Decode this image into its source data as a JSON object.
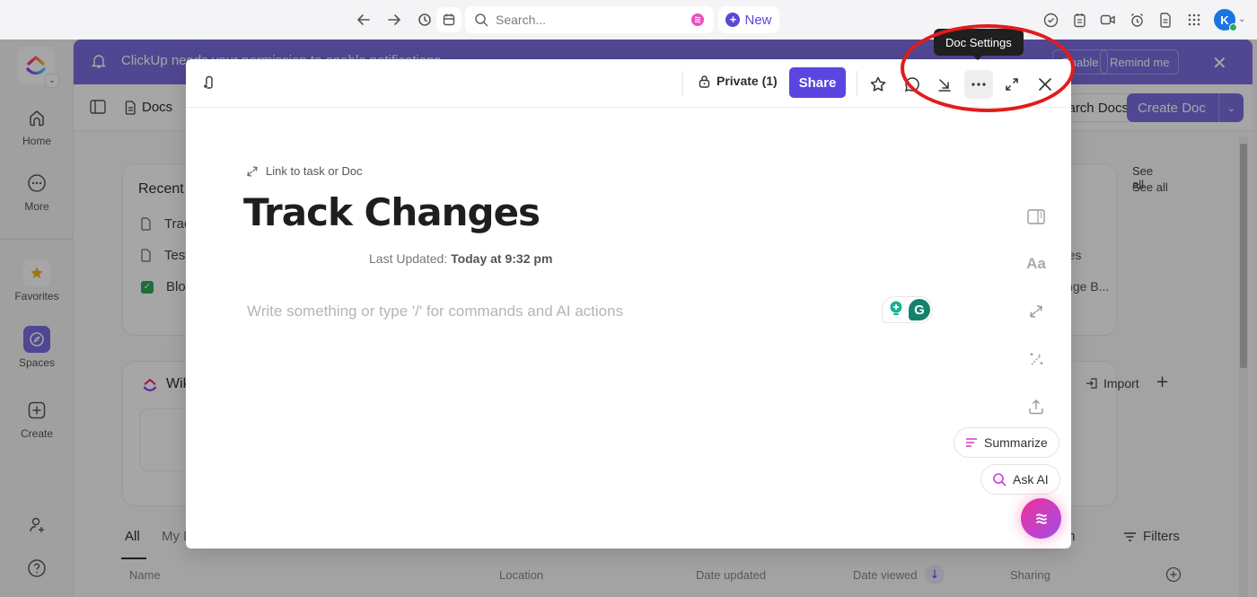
{
  "topbar": {
    "nav_icons": [
      "back-arrow-icon",
      "forward-arrow-icon",
      "history-icon"
    ],
    "calendar_icon": "calendar-icon",
    "search": {
      "placeholder": "Search...",
      "ai_icon": "clickup-brain-icon"
    },
    "new_button": {
      "label": "New",
      "icon": "plus-circle-icon"
    },
    "right_icons": [
      "check-circle-icon",
      "notepad-icon",
      "video-icon",
      "alarm-clock-icon",
      "document-icon",
      "apps-grid-icon"
    ],
    "avatar": {
      "initial": "K",
      "status": "online"
    }
  },
  "sidebar": {
    "workspace_logo": "clickup-logo",
    "items": [
      {
        "label": "Home",
        "icon": "home-icon"
      },
      {
        "label": "More",
        "icon": "more-circle-icon"
      },
      {
        "label": "Favorites",
        "icon": "star-icon"
      },
      {
        "label": "Spaces",
        "icon": "compass-icon",
        "active": true
      },
      {
        "label": "Create",
        "icon": "plus-square-icon"
      }
    ],
    "bottom_icons": [
      "invite-user-icon",
      "help-icon"
    ]
  },
  "banner": {
    "text": "ClickUp needs your permission to enable notifications",
    "enable_label": "Enable",
    "remind_label": "Remind me"
  },
  "docs_header": {
    "title": "Docs",
    "search_label": "Search Docs",
    "create_label": "Create Doc"
  },
  "background": {
    "recent": {
      "title": "Recent",
      "items": [
        {
          "label": "Track Changes",
          "icon": "document-icon"
        },
        {
          "label": "Test",
          "icon": "document-icon"
        },
        {
          "label": "Blog",
          "icon": "checkbox-icon"
        }
      ],
      "right_items": [
        "Track Changes",
        "Climate Change B..."
      ],
      "see_all": "See all"
    },
    "wiki": {
      "title": "Wikis",
      "import_label": "Import"
    },
    "tabs": [
      {
        "label": "All",
        "active": true
      },
      {
        "label": "My Docs"
      }
    ],
    "search_label": "Search",
    "filters_label": "Filters",
    "table_columns": [
      "Name",
      "Location",
      "Date updated",
      "Date viewed",
      "Sharing"
    ]
  },
  "modal": {
    "privacy_label": "Private (1)",
    "share_label": "Share",
    "tooltip": "Doc Settings",
    "header_icons": [
      "star-icon",
      "comment-icon",
      "download-icon",
      "more-options-icon",
      "expand-icon",
      "close-icon"
    ],
    "link_label": "Link to task or Doc",
    "title": "Track Changes",
    "last_updated_label": "Last Updated:",
    "last_updated_value": "Today at 9:32 pm",
    "editor_placeholder": "Write something or type '/' for commands and AI actions",
    "side_tools": [
      "layout-panel-icon",
      "text-format-icon",
      "link-icon",
      "magic-wand-icon",
      "export-icon"
    ],
    "text_format_label": "Aa",
    "grammarly_letter": "G",
    "ai_actions": [
      {
        "label": "Summarize",
        "icon": "summarize-icon"
      },
      {
        "label": "Ask AI",
        "icon": "search-ai-icon"
      }
    ]
  },
  "colors": {
    "brand_purple": "#5b45e0",
    "banner_purple": "#7b6ee0",
    "annotation_red": "#e31b1b",
    "ai_gradient_start": "#f0309a",
    "ai_gradient_end": "#a04ee8"
  }
}
